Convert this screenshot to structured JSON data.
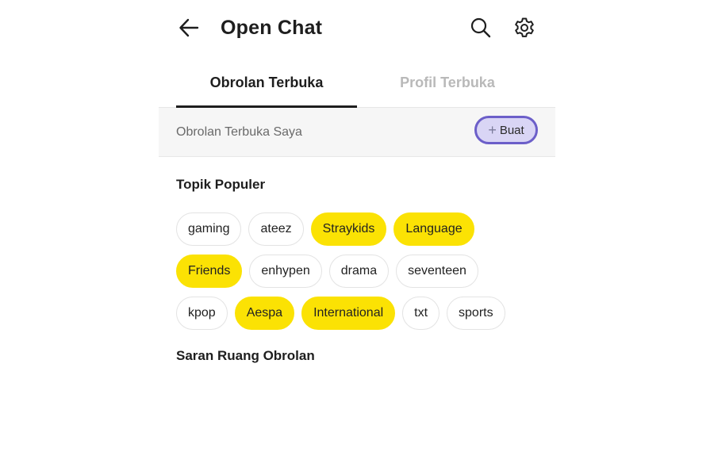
{
  "header": {
    "title": "Open Chat",
    "back_icon": "arrow-left-icon",
    "search_icon": "search-icon",
    "settings_icon": "gear-icon"
  },
  "tabs": [
    {
      "label": "Obrolan Terbuka",
      "active": true
    },
    {
      "label": "Profil Terbuka",
      "active": false
    }
  ],
  "my_chats": {
    "label": "Obrolan Terbuka Saya",
    "create_button": "Buat",
    "create_icon": "plus-icon"
  },
  "popular": {
    "title": "Topik Populer",
    "rows": [
      [
        {
          "label": "gaming",
          "highlighted": false
        },
        {
          "label": "ateez",
          "highlighted": false
        },
        {
          "label": "Straykids",
          "highlighted": true
        },
        {
          "label": "Language",
          "highlighted": true
        }
      ],
      [
        {
          "label": "Friends",
          "highlighted": true
        },
        {
          "label": "enhypen",
          "highlighted": false
        },
        {
          "label": "drama",
          "highlighted": false
        },
        {
          "label": "seventeen",
          "highlighted": false
        }
      ],
      [
        {
          "label": "kpop",
          "highlighted": false
        },
        {
          "label": "Aespa",
          "highlighted": true
        },
        {
          "label": "International",
          "highlighted": true
        },
        {
          "label": "txt",
          "highlighted": false
        },
        {
          "label": "sports",
          "highlighted": false
        }
      ]
    ]
  },
  "suggestions": {
    "title": "Saran Ruang Obrolan"
  },
  "colors": {
    "highlight_chip": "#fbe204",
    "create_button_border": "#6c5fc9",
    "create_button_fill": "#d9d5f5",
    "inactive_tab": "#b9b9b9"
  }
}
